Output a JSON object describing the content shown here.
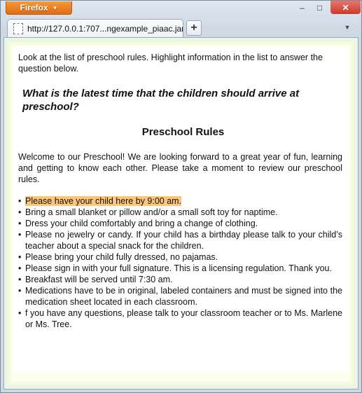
{
  "browser": {
    "menu_label": "Firefox",
    "tab_title": "http://127.0.0.1:707...ngexample_piaac.jar/",
    "new_tab_symbol": "+"
  },
  "content": {
    "instructions": "Look at the list of preschool rules. Highlight information in the list to answer the question below.",
    "question": "What is the latest time that the children should arrive at preschool?",
    "document_title": "Preschool Rules",
    "welcome": "Welcome to our Preschool! We are looking forward to a great year of fun, learning and getting to know each other. Please take a moment to review our preschool rules.",
    "rules": [
      "Please have your child here by 9:00 am.",
      "Bring a small blanket or pillow and/or a small soft toy for naptime.",
      "Dress your child comfortably and bring a change of clothing.",
      "Please no jewelry or candy. If your child has a birthday please talk to your child’s teacher about a special snack for the children.",
      "Please bring your child fully dressed, no pajamas.",
      "Please sign in with your full signature. This is a licensing regulation. Thank you.",
      "Breakfast will be served until 7:30 am.",
      "Medications have to be in original, labeled containers and must be signed into the medication sheet located in each classroom.",
      "f you have any questions, please talk to your classroom teacher or to Ms. Marlene or Ms. Tree."
    ],
    "highlighted_rule_index": 0,
    "highlight_color": "#fcc67a"
  },
  "icons": {
    "bullet": "•",
    "minimize": "–",
    "maximize": "□",
    "close": "✕",
    "dropdown": "▼"
  }
}
